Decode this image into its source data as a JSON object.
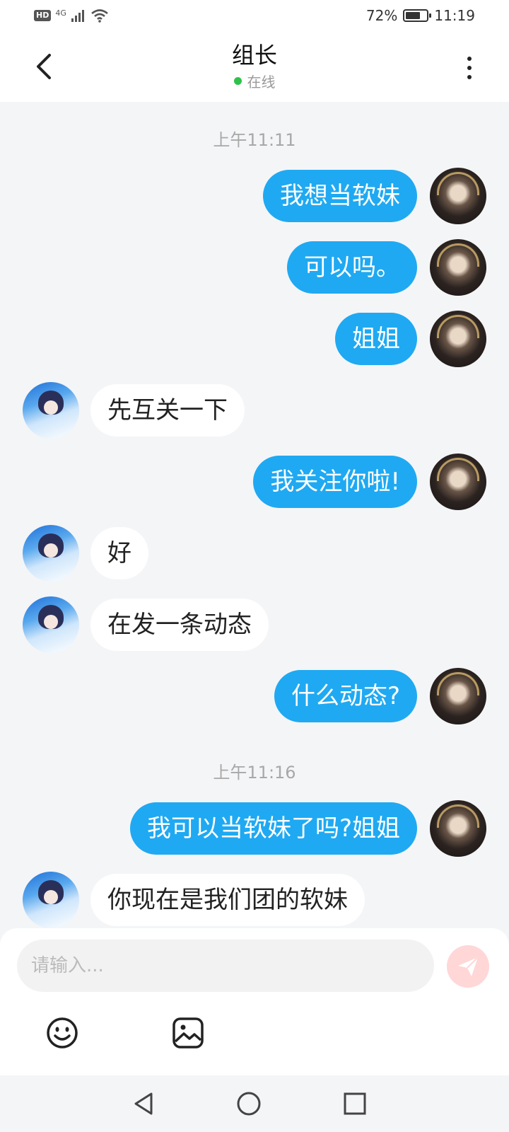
{
  "status_bar": {
    "hd": "HD",
    "network": "4G",
    "battery_text": "72%",
    "battery_level": 0.72,
    "time": "11:19"
  },
  "header": {
    "title": "组长",
    "status": "在线",
    "status_color": "#2ec24a"
  },
  "messages": {
    "ts1": "上午11:11",
    "m1": "我想当软妹",
    "m2": "可以吗。",
    "m3": "姐姐",
    "m4": "先互关一下",
    "m5": "我关注你啦!",
    "m6": "好",
    "m7": "在发一条动态",
    "m8": "什么动态?",
    "ts2": "上午11:16",
    "m9": "我可以当软妹了吗?姐姐",
    "m10": "你现在是我们团的软妹"
  },
  "input": {
    "placeholder": "请输入..."
  },
  "colors": {
    "accent": "#1fa9f2",
    "send_disabled": "#ffd7d7"
  },
  "icons": {
    "emoji": "emoji-icon",
    "image": "image-icon",
    "send": "send-icon",
    "back": "back-arrow-icon",
    "more": "more-vertical-icon"
  }
}
